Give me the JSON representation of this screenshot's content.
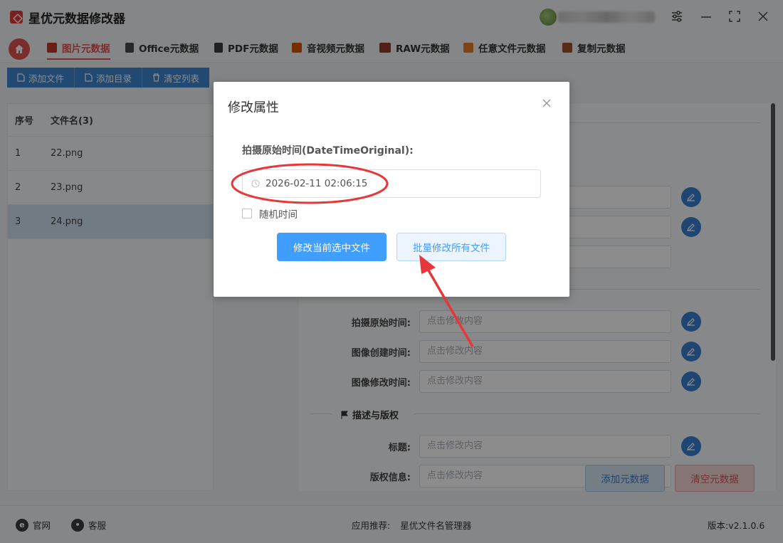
{
  "window": {
    "title": "星优元数据修改器",
    "controls": [
      "settings-icon",
      "minimize-icon",
      "maximize-icon",
      "close-icon"
    ]
  },
  "nav": {
    "tabs": [
      {
        "label": "图片元数据",
        "icon": "image-icon",
        "active": true
      },
      {
        "label": "Office元数据",
        "icon": "office-icon",
        "active": false
      },
      {
        "label": "PDF元数据",
        "icon": "pdf-icon",
        "active": false
      },
      {
        "label": "音视频元数据",
        "icon": "video-icon",
        "active": false
      },
      {
        "label": "RAW元数据",
        "icon": "camera-icon",
        "active": false
      },
      {
        "label": "任意文件元数据",
        "icon": "file-icon",
        "active": false
      },
      {
        "label": "复制元数据",
        "icon": "copy-icon",
        "active": false
      }
    ]
  },
  "toolbar": {
    "add_file": "添加文件",
    "add_dir": "添加目录",
    "clear_list": "清空列表"
  },
  "filelist": {
    "col_no": "序号",
    "col_name": "文件名(3)",
    "rows": [
      {
        "no": "1",
        "name": "22.png",
        "selected": false
      },
      {
        "no": "2",
        "name": "23.png",
        "selected": false
      },
      {
        "no": "3",
        "name": "24.png",
        "selected": true
      }
    ]
  },
  "metadata": {
    "placeholder": "点击修改内容",
    "time_fields": {
      "original": "拍摄原始时间:",
      "created": "图像创建时间:",
      "modified": "图像修改时间:"
    },
    "section_desc": "描述与版权",
    "desc_fields": {
      "title": "标题:",
      "copyright": "版权信息:"
    },
    "add_button": "添加元数据",
    "clear_button": "清空元数据"
  },
  "statusbar": {
    "website": "官网",
    "support": "客服",
    "recommend_label": "应用推荐:",
    "recommend_app": "星优文件名管理器",
    "version": "版本:v2.1.0.6"
  },
  "dialog": {
    "title": "修改属性",
    "field_label": "拍摄原始时间(DateTimeOriginal):",
    "datetime_value": "2026-02-11 02:06:15",
    "random_time_label": "随机时间",
    "random_time_checked": false,
    "btn_current": "修改当前选中文件",
    "btn_batch": "批量修改所有文件"
  },
  "colors": {
    "accent_red": "#e0534f",
    "primary_blue": "#409eff",
    "toolbar_blue": "#3e86cf",
    "annotation_red": "#e8373a"
  }
}
